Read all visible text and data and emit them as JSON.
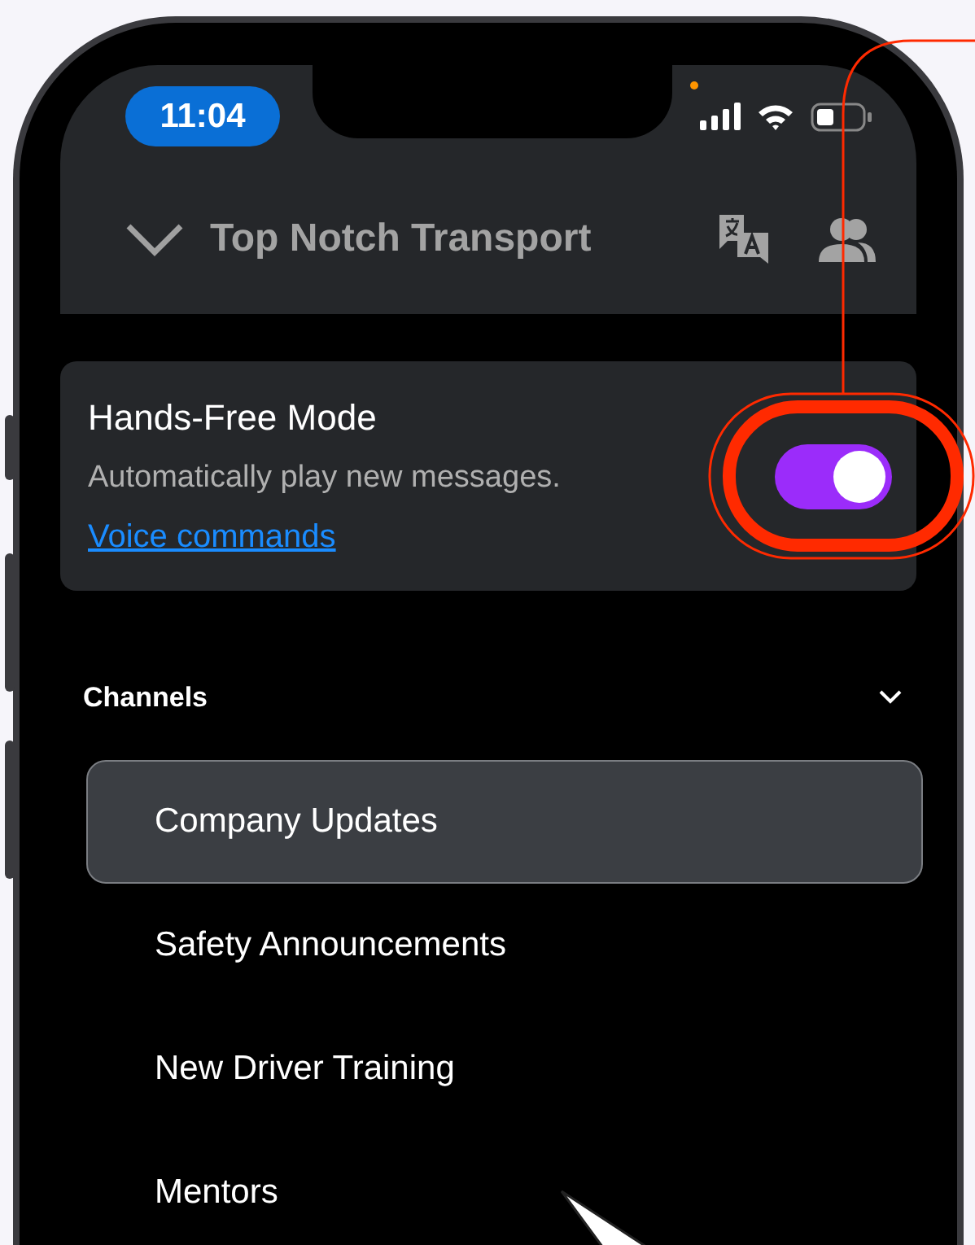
{
  "status_bar": {
    "time": "11:04"
  },
  "header": {
    "title": "Top Notch Transport"
  },
  "hands_free": {
    "title": "Hands-Free Mode",
    "subtitle": "Automatically play new messages.",
    "link": "Voice commands",
    "on": true
  },
  "channels": {
    "label": "Channels",
    "expanded": true,
    "items": [
      {
        "label": "Company Updates",
        "selected": true
      },
      {
        "label": "Safety Announcements",
        "selected": false
      },
      {
        "label": "New Driver Training",
        "selected": false
      },
      {
        "label": "Mentors",
        "selected": false
      }
    ]
  }
}
